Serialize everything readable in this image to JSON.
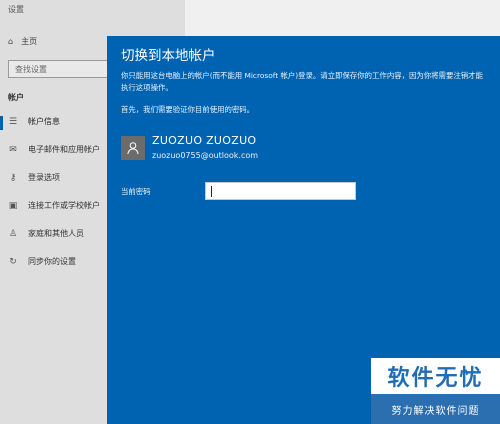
{
  "window": {
    "title": "设置"
  },
  "sidebar": {
    "home_label": "主页",
    "search_placeholder": "查找设置",
    "section_title": "帐户",
    "items": [
      {
        "label": "帐户信息",
        "icon": "person-lines-icon",
        "active": true
      },
      {
        "label": "电子邮件和应用帐户",
        "icon": "mail-icon",
        "active": false
      },
      {
        "label": "登录选项",
        "icon": "key-icon",
        "active": false
      },
      {
        "label": "连接工作或学校帐户",
        "icon": "briefcase-icon",
        "active": false
      },
      {
        "label": "家庭和其他人员",
        "icon": "person-add-icon",
        "active": false
      },
      {
        "label": "同步你的设置",
        "icon": "sync-icon",
        "active": false
      }
    ]
  },
  "dialog": {
    "title": "切换到本地帐户",
    "description": "你只能用这台电脑上的帐户(而不能用 Microsoft 帐户)登录。请立即保存你的工作内容，因为你将需要注销才能执行这项操作。",
    "first_step": "首先，我们需要验证你目前使用的密码。",
    "user": {
      "name": "ZUOZUO ZUOZUO",
      "email": "zuozuo0755@outlook.com"
    },
    "password_label": "当前密码",
    "password_value": ""
  },
  "watermark": {
    "title": "软件无忧",
    "subtitle": "努力解决软件问题"
  },
  "colors": {
    "dialog_bg": "#0063b1",
    "accent": "#0063b1"
  }
}
